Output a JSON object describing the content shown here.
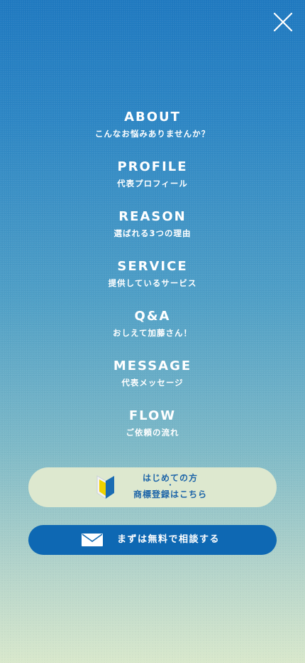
{
  "menu": {
    "items": [
      {
        "en": "ABOUT",
        "ja": "こんなお悩みありませんか？"
      },
      {
        "en": "PROFILE",
        "ja": "代表プロフィール"
      },
      {
        "en": "REASON",
        "ja": "選ばれる3つの理由"
      },
      {
        "en": "SERVICE",
        "ja": "提供しているサービス"
      },
      {
        "en": "Q&A",
        "ja": "おしえて加藤さん！"
      },
      {
        "en": "MESSAGE",
        "ja": "代表メッセージ"
      },
      {
        "en": "FLOW",
        "ja": "ご依頼の流れ"
      }
    ]
  },
  "beginner_button": {
    "line1": "はじめての方",
    "dot": "・",
    "line2": "商標登録はこちら"
  },
  "consult_button": {
    "label": "まずは無料で相談する"
  },
  "icons": {
    "close": "close-icon",
    "beginner_mark": "beginner-mark-icon",
    "mail": "mail-icon"
  },
  "colors": {
    "top_gradient": "#1f79c0",
    "bottom_gradient": "#d9e8cc",
    "beginner_button_bg": "#dde8cf",
    "beginner_text": "#1c64a8",
    "consult_button_bg": "#0e68b3"
  }
}
